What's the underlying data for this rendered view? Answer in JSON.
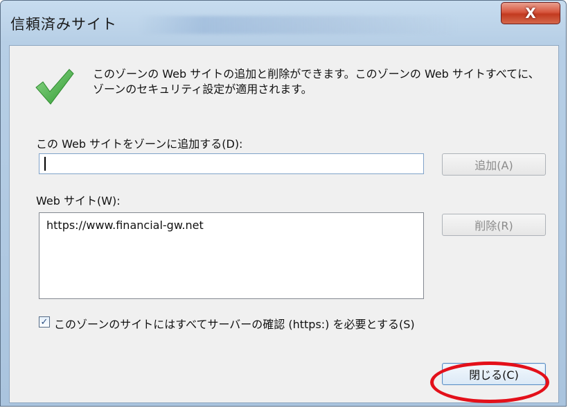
{
  "window": {
    "title": "信頼済みサイト",
    "close_glyph": "X"
  },
  "icons": {
    "check": "checkmark-icon",
    "check_color": "#3aa63a"
  },
  "dialog": {
    "description": "このゾーンの Web サイトの追加と削除ができます。このゾーンの Web サイトすべてに、ゾーンのセキュリティ設定が適用されます。",
    "add_label": "この Web サイトをゾーンに追加する(D):",
    "add_input_value": "",
    "add_button": "追加(A)",
    "sites_label": "Web サイト(W):",
    "sites": [
      "https://www.financial-gw.net"
    ],
    "remove_button": "削除(R)",
    "https_checkbox_checked": true,
    "https_checkbox_label": "このゾーンのサイトにはすべてサーバーの確認 (https:) を必要とする(S)",
    "close_button": "閉じる(C)"
  },
  "annotation": {
    "color": "#e3101a"
  }
}
